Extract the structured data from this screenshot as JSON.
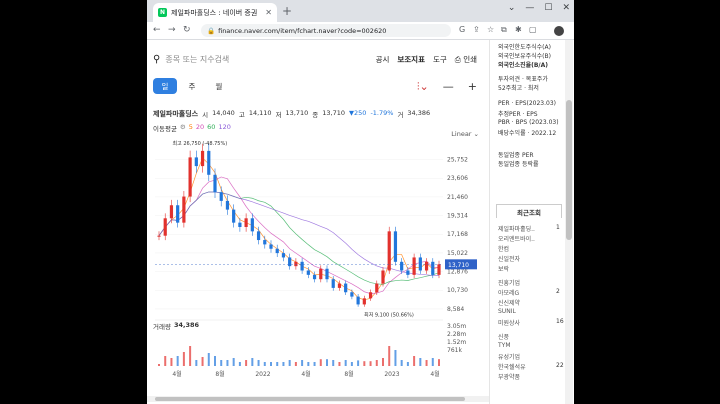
{
  "browser": {
    "tab_title": "제일파마홀딩스 : 네이버 증권",
    "favicon": "N",
    "url": "finance.naver.com/item/fchart.naver?code=002620"
  },
  "search": {
    "placeholder": "종목 또는 지수검색"
  },
  "toplinks": [
    "공시",
    "보조지표",
    "도구",
    "인쇄"
  ],
  "period": [
    "일",
    "주",
    "월"
  ],
  "quote": {
    "name": "제일파마홀딩스",
    "open_label": "시",
    "open": "14,040",
    "high_label": "고",
    "high": "14,110",
    "low_label": "저",
    "low": "13,710",
    "close_label": "종",
    "close": "13,710",
    "change": "▼250",
    "pct": "-1.79%",
    "vol_label": "거",
    "volume": "34,386"
  },
  "ma": {
    "label": "이동평균",
    "periods": [
      "5",
      "20",
      "60",
      "120"
    ]
  },
  "scale": "Linear",
  "volume_label": {
    "label": "거래량",
    "value": "34,386"
  },
  "colors": {
    "up": "#e2312d",
    "down": "#2176db",
    "ma5": "#ff7a00",
    "ma20": "#d14bb5",
    "ma60": "#2fae57",
    "ma120": "#8a5ad8",
    "accent": "#2f7fe0",
    "current_box": "#2f62c8"
  },
  "chart_data": {
    "type": "line",
    "x_labels": [
      "4월",
      "8월",
      "2022",
      "4월",
      "8월",
      "2023",
      "4월"
    ],
    "ylim": [
      8000,
      28000
    ],
    "y_ticks": [
      25752,
      23606,
      21460,
      19314,
      17168,
      15022,
      12876,
      10730,
      8584
    ],
    "y_tick_labels": [
      "25,752",
      "23,606",
      "21,460",
      "19,314",
      "17,168",
      "15,022",
      "12,876",
      "10,730",
      "8,584"
    ],
    "current": "13,710",
    "max_label": "최고 26,750 (-48.75%)",
    "min_label": "최저 9,100 (50.66%)",
    "vol_ticks": [
      "3.05m",
      "2.28m",
      "1.52m",
      "761k"
    ],
    "series": [
      {
        "name": "종가",
        "values": [
          17000,
          19000,
          20500,
          18500,
          21500,
          26000,
          25000,
          26750,
          24000,
          22000,
          21000,
          20000,
          18500,
          18000,
          19000,
          17500,
          16500,
          16000,
          15500,
          15000,
          14500,
          13500,
          14000,
          13000,
          12500,
          12000,
          13200,
          12000,
          11000,
          11500,
          10500,
          10000,
          9100,
          9800,
          10500,
          11500,
          13000,
          17500,
          14000,
          13000,
          12500,
          14500,
          13000,
          14000,
          12500,
          13710
        ]
      }
    ]
  },
  "sidebar": {
    "lines": [
      "외국인한도주식수(A)",
      "외국인보유주식수(B)",
      "외국인소진율(B/A)",
      "투자의견 · 목표주가",
      "52주최고 · 최저",
      "PER · EPS(2023.03)",
      "추정PER · EPS",
      "PBR · BPS (2023.03)",
      "배당수익률 · 2022.12",
      "동일업종 PER",
      "동일업종 등락률"
    ],
    "recent_title": "최근조회",
    "recent": [
      "제일파마홀딩..",
      "오리엔트바이..",
      "한컴",
      "신일전자",
      "보락",
      "진흥기업",
      "아모레G",
      "신신제약",
      "SUNIL",
      "미원상사",
      "신풍",
      "TYM",
      "유성기업",
      "한국쉘석유",
      "부광약품"
    ],
    "recent_counts": [
      "1",
      "",
      "",
      "",
      "",
      "",
      "2",
      "",
      "",
      "16",
      "",
      "",
      "",
      "22",
      ""
    ]
  }
}
